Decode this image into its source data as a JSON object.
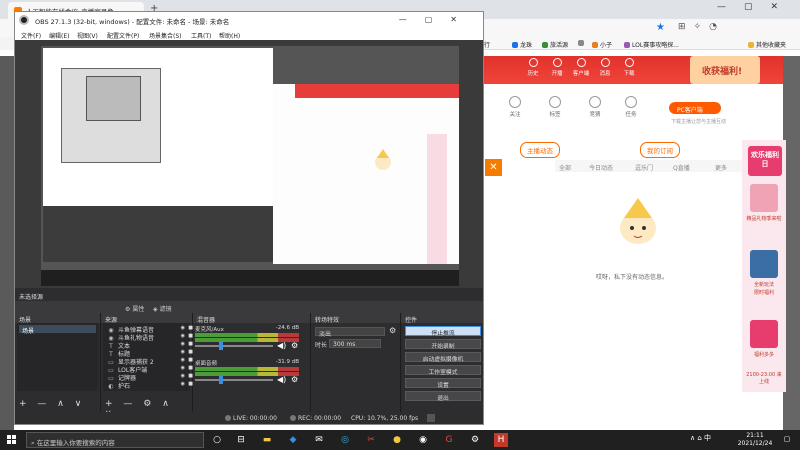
{
  "browser": {
    "tab_title": "人工智能在线会议_直播室录像",
    "new_tab": "+",
    "window_controls": [
      "—",
      "▢",
      "✕"
    ],
    "bookmarks": [
      {
        "label": "行",
        "color": "#e9a03a"
      },
      {
        "label": "龙珠",
        "color": "#1a73e8"
      },
      {
        "label": "旅活源",
        "color": "#3a8e3a"
      },
      {
        "label": "",
        "color": "#888888"
      },
      {
        "label": "小子",
        "color": "#e67e22"
      },
      {
        "label": "LOL赛事攻略探...",
        "color": "#9b59b6"
      },
      {
        "label": "其他收藏夹",
        "color": "#e9b33a"
      }
    ],
    "nav_items": [
      "历史",
      "开播",
      "客户端",
      "消息",
      "下载"
    ],
    "promo_text": "收获福利!",
    "quick_icons": [
      "关注",
      "标签",
      "竞猜",
      "任务"
    ],
    "pc_button": "PC客户端",
    "pc_sub": "下载主播让您与主播互动",
    "follow": {
      "tab1": "主播动态",
      "tab2": "我的订阅",
      "filters": [
        "全部",
        "今日动态",
        "逗乐门",
        "Q直播",
        "更多"
      ]
    },
    "empty_text": "哎呀，私下没有动态信息。",
    "side_banner": {
      "title": "欢乐福利日",
      "texts": [
        "精品礼物季来啦",
        "全新玩法",
        "限时福利",
        "福利多多",
        "2100-23:00 来上线"
      ]
    },
    "orange_btn": "✕"
  },
  "obs": {
    "title": "OBS 27.1.3 (32-bit, windows) - 配置文件: 未命名 - 场景: 未命名",
    "window_controls": [
      "—",
      "▢",
      "✕"
    ],
    "menu": [
      "文件(F)",
      "编辑(E)",
      "视图(V)",
      "配置文件(P)",
      "场景集合(S)",
      "工具(T)",
      "帮助(H)"
    ],
    "no_source": "未选择源",
    "props_btn": "属性",
    "filters_btn": "滤镜",
    "docks": {
      "scenes": {
        "title": "场景",
        "items": [
          "场景"
        ],
        "footer": "+ — ∧ ∨"
      },
      "sources": {
        "title": "来源",
        "items": [
          {
            "icon": "speaker",
            "glyph": "◉",
            "label": "斗鱼弹幕语音"
          },
          {
            "icon": "speaker",
            "glyph": "◉",
            "label": "斗鱼礼物语音"
          },
          {
            "icon": "text",
            "glyph": "T",
            "label": "文本"
          },
          {
            "icon": "text",
            "glyph": "T",
            "label": "标题"
          },
          {
            "icon": "monitor",
            "glyph": "▭",
            "label": "显示器捕获 2"
          },
          {
            "icon": "monitor",
            "glyph": "▭",
            "label": "LOL客户端"
          },
          {
            "icon": "monitor",
            "glyph": "▭",
            "label": "记牌器"
          },
          {
            "icon": "camera",
            "glyph": "◐",
            "label": "护石"
          }
        ],
        "footer": "+ — ⚙ ∧ ∨"
      },
      "mixer": {
        "title": "混音器",
        "channels": [
          {
            "name": "麦克风/Aux",
            "db": "-24.6 dB",
            "volume": 0.3
          },
          {
            "name": "桌面音频",
            "db": "-31.9 dB",
            "volume": 0.3
          }
        ]
      },
      "transitions": {
        "title": "转场特效",
        "selected": "淡出",
        "duration_label": "时长",
        "duration": "300 ms"
      },
      "controls": {
        "title": "控件",
        "buttons": [
          "停止推流",
          "开始录制",
          "启动虚拟摄像机",
          "工作室模式",
          "设置",
          "退出"
        ]
      }
    },
    "status": {
      "live": "LIVE: 00:00:00",
      "rec": "REC: 00:00:00",
      "cpu": "CPU: 10.7%, 25.00 fps"
    }
  },
  "taskbar": {
    "search_placeholder": "在这里输入你要搜索的内容",
    "apps": [
      "task-view-icon",
      "widgets-icon",
      "file-explorer-icon",
      "store-icon",
      "mail-icon",
      "edge-icon",
      "tool-icon",
      "game-icon",
      "obs-icon",
      "browser-icon",
      "settings-icon",
      "app-icon"
    ],
    "tray": "∧ ⌂ 中",
    "time": "21:11",
    "date": "2021/12/24"
  }
}
